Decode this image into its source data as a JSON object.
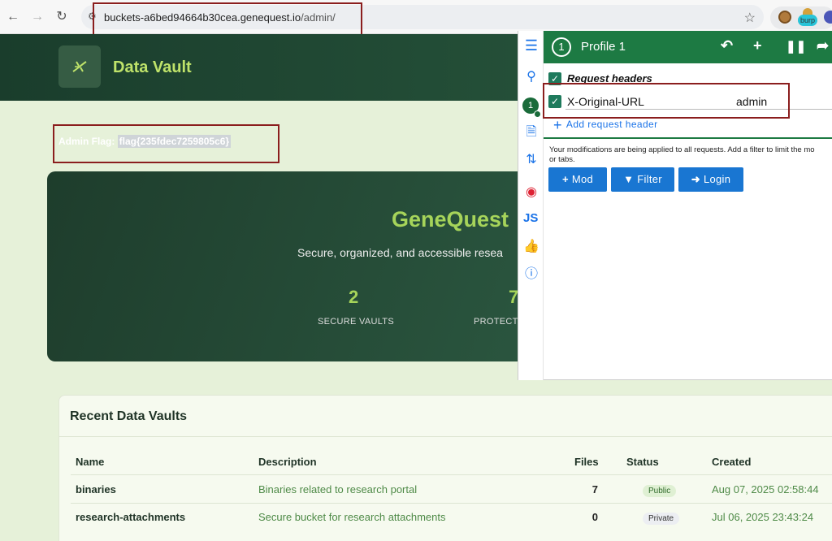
{
  "browser": {
    "url_host": "buckets-a6bed94664b30cea.genequest.io",
    "url_path": "/admin/",
    "extensions": {
      "burp_label": "burp"
    }
  },
  "site": {
    "title": "Data Vault"
  },
  "admin_flag": {
    "label": "Admin Flag:",
    "value": "flag{235fdec7259805c6}"
  },
  "hero": {
    "title": "GeneQuest",
    "subtitle": "Secure, organized, and accessible resea",
    "stats": [
      {
        "value": "2",
        "label": "SECURE VAULTS"
      },
      {
        "value": "7",
        "label": "PROTECTE"
      }
    ]
  },
  "recent": {
    "title": "Recent Data Vaults",
    "columns": [
      "Name",
      "Description",
      "Files",
      "Status",
      "Created"
    ],
    "rows": [
      {
        "name": "binaries",
        "description": "Binaries related to research portal",
        "files": "7",
        "status": "Public",
        "created": "Aug 07, 2025 02:58:44"
      },
      {
        "name": "research-attachments",
        "description": "Secure bucket for research attachments",
        "files": "0",
        "status": "Private",
        "created": "Jul 06, 2025 23:43:24"
      }
    ]
  },
  "extension": {
    "profile_number": "1",
    "profile_name": "Profile 1",
    "sidebar_badge": "1",
    "js_label": "JS",
    "section_label": "Request headers",
    "header_name": "X-Original-URL",
    "header_value": "admin",
    "add_header_label": "Add request header",
    "note": "Your modifications are being applied to all requests. Add a filter to limit the mo",
    "note_line2": "or tabs.",
    "buttons": {
      "mod": "Mod",
      "filter": "Filter",
      "login": "Login"
    }
  },
  "colors": {
    "accent_green": "#1d7a43",
    "brand_lime": "#a6d45a",
    "link_blue": "#1a73e8",
    "annotation_red": "#8b1e1e"
  }
}
